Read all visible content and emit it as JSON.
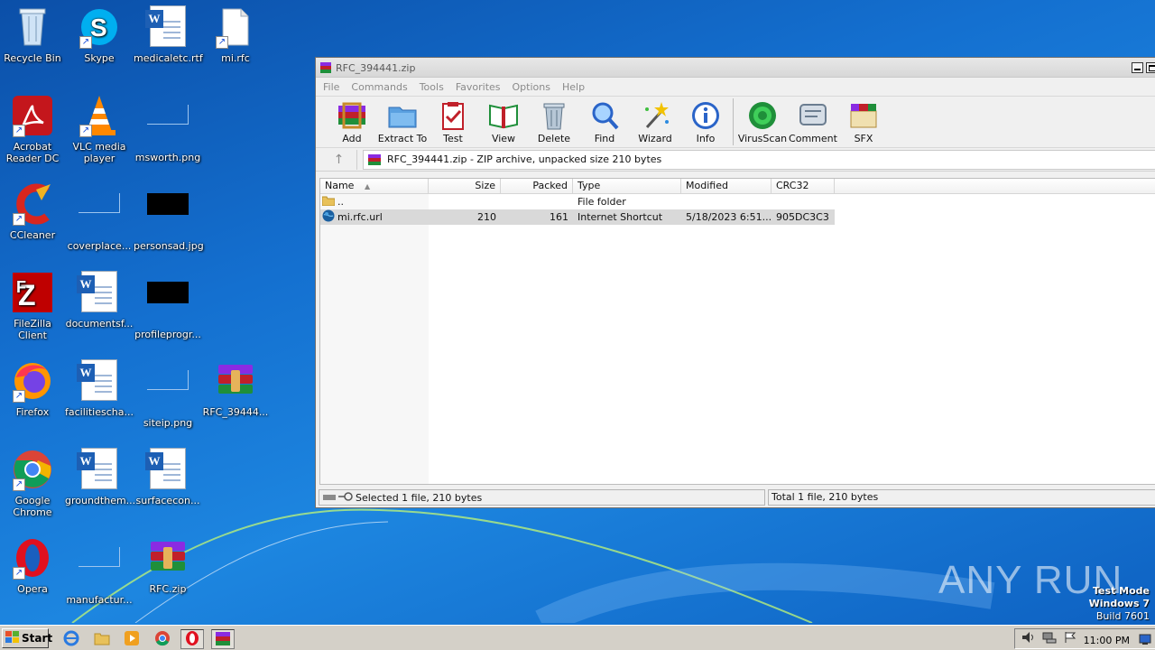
{
  "desktop": {
    "icons": [
      {
        "label": "Recycle Bin"
      },
      {
        "label": "Skype"
      },
      {
        "label": "medicaletc.rtf"
      },
      {
        "label": "mi.rfc"
      },
      {
        "label": "Acrobat Reader DC"
      },
      {
        "label": "VLC media player"
      },
      {
        "label": "msworth.png"
      },
      {
        "label": "CCleaner"
      },
      {
        "label": "coverplace..."
      },
      {
        "label": "personsad.jpg"
      },
      {
        "label": "FileZilla Client"
      },
      {
        "label": "documentsf..."
      },
      {
        "label": "profileprogr..."
      },
      {
        "label": "Firefox"
      },
      {
        "label": "facilitiescha..."
      },
      {
        "label": "siteip.png"
      },
      {
        "label": "RFC_39444..."
      },
      {
        "label": "Google Chrome"
      },
      {
        "label": "groundthem..."
      },
      {
        "label": "surfacecon..."
      },
      {
        "label": "Opera"
      },
      {
        "label": "manufactur..."
      },
      {
        "label": "RFC.zip"
      }
    ]
  },
  "window": {
    "title": "RFC_394441.zip",
    "menu": [
      "File",
      "Commands",
      "Tools",
      "Favorites",
      "Options",
      "Help"
    ],
    "toolbar": [
      {
        "label": "Add",
        "icon": "add-icon"
      },
      {
        "label": "Extract To",
        "icon": "extract-folder-icon"
      },
      {
        "label": "Test",
        "icon": "test-clipboard-icon"
      },
      {
        "label": "View",
        "icon": "view-book-icon"
      },
      {
        "label": "Delete",
        "icon": "trash-icon"
      },
      {
        "label": "Find",
        "icon": "magnifier-icon"
      },
      {
        "label": "Wizard",
        "icon": "wand-icon"
      },
      {
        "label": "Info",
        "icon": "info-icon"
      },
      {
        "label": "VirusScan",
        "icon": "virus-scan-icon"
      },
      {
        "label": "Comment",
        "icon": "comment-icon"
      },
      {
        "label": "SFX",
        "icon": "sfx-icon"
      }
    ],
    "address": "RFC_394441.zip - ZIP archive, unpacked size 210 bytes",
    "columns": [
      "Name",
      "Size",
      "Packed",
      "Type",
      "Modified",
      "CRC32"
    ],
    "rows": [
      {
        "name": "..",
        "size": "",
        "packed": "",
        "type": "File folder",
        "modified": "",
        "crc": "",
        "icon": "folder-icon"
      },
      {
        "name": "mi.rfc.url",
        "size": "210",
        "packed": "161",
        "type": "Internet Shortcut",
        "modified": "5/18/2023 6:51...",
        "crc": "905DC3C3",
        "icon": "globe-icon"
      }
    ],
    "status_left": "Selected 1 file, 210 bytes",
    "status_right": "Total 1 file, 210 bytes"
  },
  "taskbar": {
    "start_label": "Start",
    "clock": "11:00 PM"
  },
  "watermark": {
    "text": "ANY RUN"
  },
  "system_notice": {
    "line1": "Test Mode",
    "line2": "Windows 7",
    "line3": "Build 7601"
  },
  "colors": {
    "wallpaper": "#1470d0",
    "taskbar": "#d4d0c8",
    "selection": "#d9d9d9"
  }
}
